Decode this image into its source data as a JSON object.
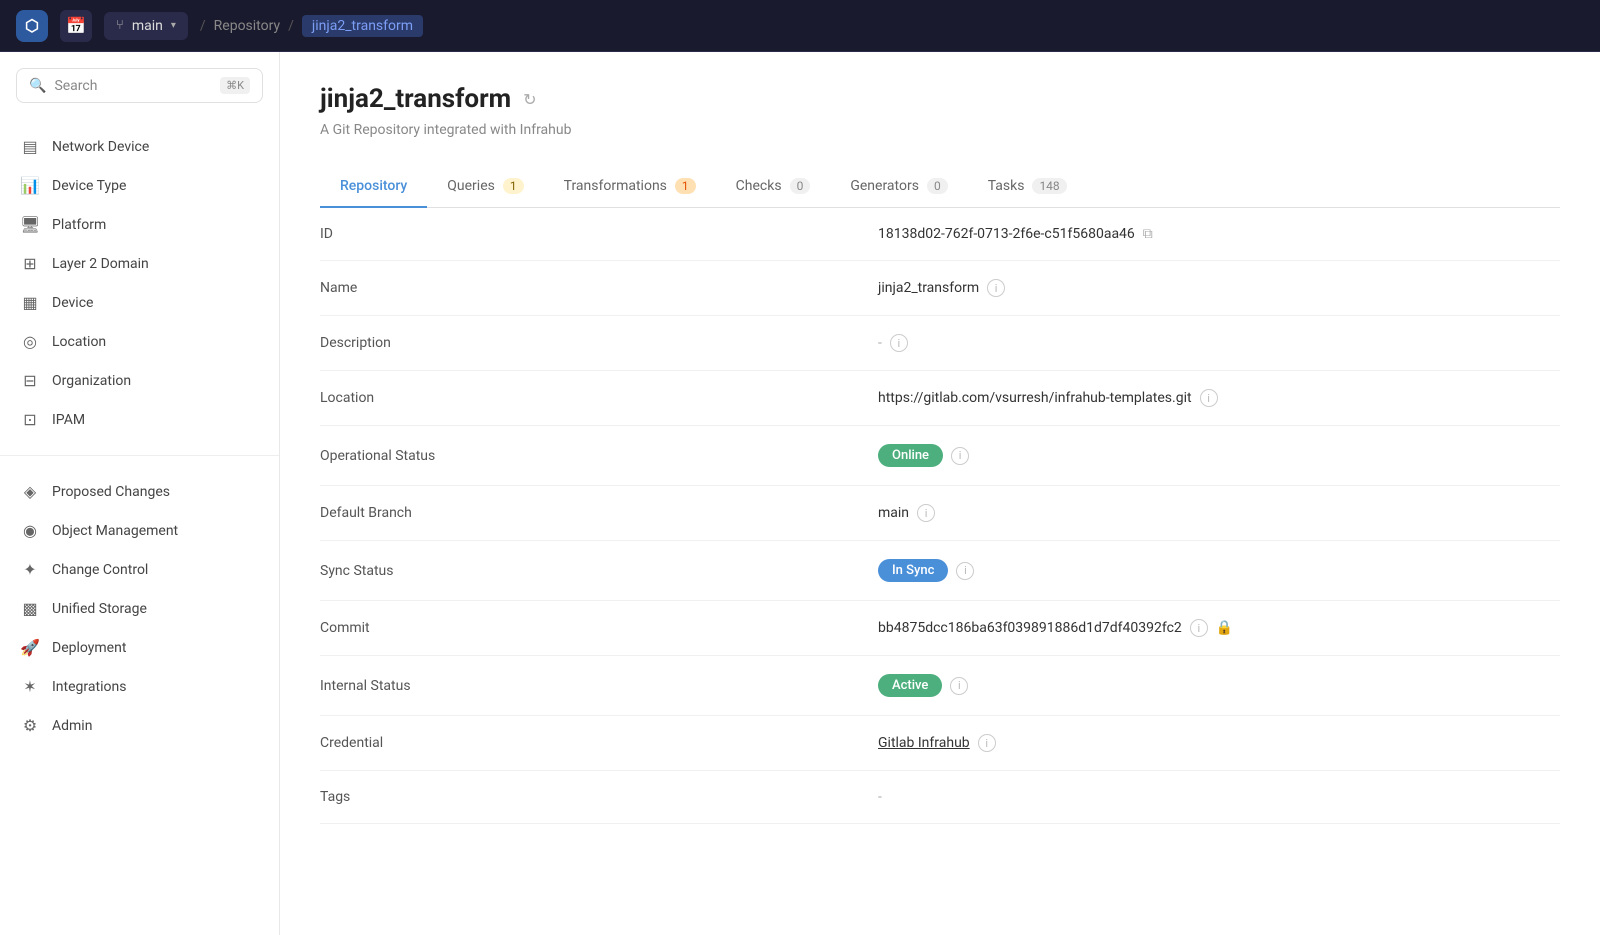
{
  "topbar": {
    "logo_text": "⬡",
    "branch_name": "main",
    "breadcrumb_items": [
      {
        "label": "Repository",
        "active": false
      },
      {
        "label": "jinja2_transform",
        "active": true
      }
    ]
  },
  "sidebar": {
    "search_placeholder": "Search",
    "search_shortcut": "⌘K",
    "nav_items_top": [
      {
        "id": "network-device",
        "label": "Network Device",
        "icon": "▤"
      },
      {
        "id": "device-type",
        "label": "Device Type",
        "icon": "📊"
      },
      {
        "id": "platform",
        "label": "Platform",
        "icon": "🖥"
      },
      {
        "id": "layer2-domain",
        "label": "Layer 2 Domain",
        "icon": "⊞"
      },
      {
        "id": "device",
        "label": "Device",
        "icon": "▦"
      },
      {
        "id": "location",
        "label": "Location",
        "icon": "◎"
      },
      {
        "id": "organization",
        "label": "Organization",
        "icon": "⊟"
      },
      {
        "id": "ipam",
        "label": "IPAM",
        "icon": "⊡"
      }
    ],
    "nav_items_bottom": [
      {
        "id": "proposed-changes",
        "label": "Proposed Changes",
        "icon": "◈"
      },
      {
        "id": "object-management",
        "label": "Object Management",
        "icon": "◉"
      },
      {
        "id": "change-control",
        "label": "Change Control",
        "icon": "✦"
      },
      {
        "id": "unified-storage",
        "label": "Unified Storage",
        "icon": "▩"
      },
      {
        "id": "deployment",
        "label": "Deployment",
        "icon": "🚀"
      },
      {
        "id": "integrations",
        "label": "Integrations",
        "icon": "✶"
      },
      {
        "id": "admin",
        "label": "Admin",
        "icon": "⚙"
      }
    ]
  },
  "page": {
    "title": "jinja2_transform",
    "subtitle": "A Git Repository integrated with Infrahub",
    "tabs": [
      {
        "id": "repository",
        "label": "Repository",
        "badge": null,
        "active": true
      },
      {
        "id": "queries",
        "label": "Queries",
        "badge": "1",
        "badge_style": "yellow",
        "active": false
      },
      {
        "id": "transformations",
        "label": "Transformations",
        "badge": "1",
        "badge_style": "orange",
        "active": false
      },
      {
        "id": "checks",
        "label": "Checks",
        "badge": "0",
        "badge_style": "normal",
        "active": false
      },
      {
        "id": "generators",
        "label": "Generators",
        "badge": "0",
        "badge_style": "normal",
        "active": false
      },
      {
        "id": "tasks",
        "label": "Tasks",
        "badge": "148",
        "badge_style": "normal",
        "active": false
      }
    ],
    "fields": [
      {
        "id": "id",
        "label": "ID",
        "value": "18138d02-762f-0713-2f6e-c51f5680aa46",
        "type": "copyable"
      },
      {
        "id": "name",
        "label": "Name",
        "value": "jinja2_transform",
        "type": "info"
      },
      {
        "id": "description",
        "label": "Description",
        "value": "-",
        "type": "dash-info"
      },
      {
        "id": "location",
        "label": "Location",
        "value": "https://gitlab.com/vsurresh/infrahub-templates.git",
        "type": "link-info"
      },
      {
        "id": "operational-status",
        "label": "Operational Status",
        "value": "Online",
        "type": "badge-green",
        "badge_info": true
      },
      {
        "id": "default-branch",
        "label": "Default Branch",
        "value": "main",
        "type": "info"
      },
      {
        "id": "sync-status",
        "label": "Sync Status",
        "value": "In Sync",
        "type": "badge-blue",
        "badge_info": true
      },
      {
        "id": "commit",
        "label": "Commit",
        "value": "bb4875dcc186ba63f039891886d1d7df40392fc2",
        "type": "commit"
      },
      {
        "id": "internal-status",
        "label": "Internal Status",
        "value": "Active",
        "type": "badge-green",
        "badge_info": true
      },
      {
        "id": "credential",
        "label": "Credential",
        "value": "Gitlab Infrahub",
        "type": "link-info"
      },
      {
        "id": "tags",
        "label": "Tags",
        "value": "-",
        "type": "dash"
      }
    ]
  }
}
